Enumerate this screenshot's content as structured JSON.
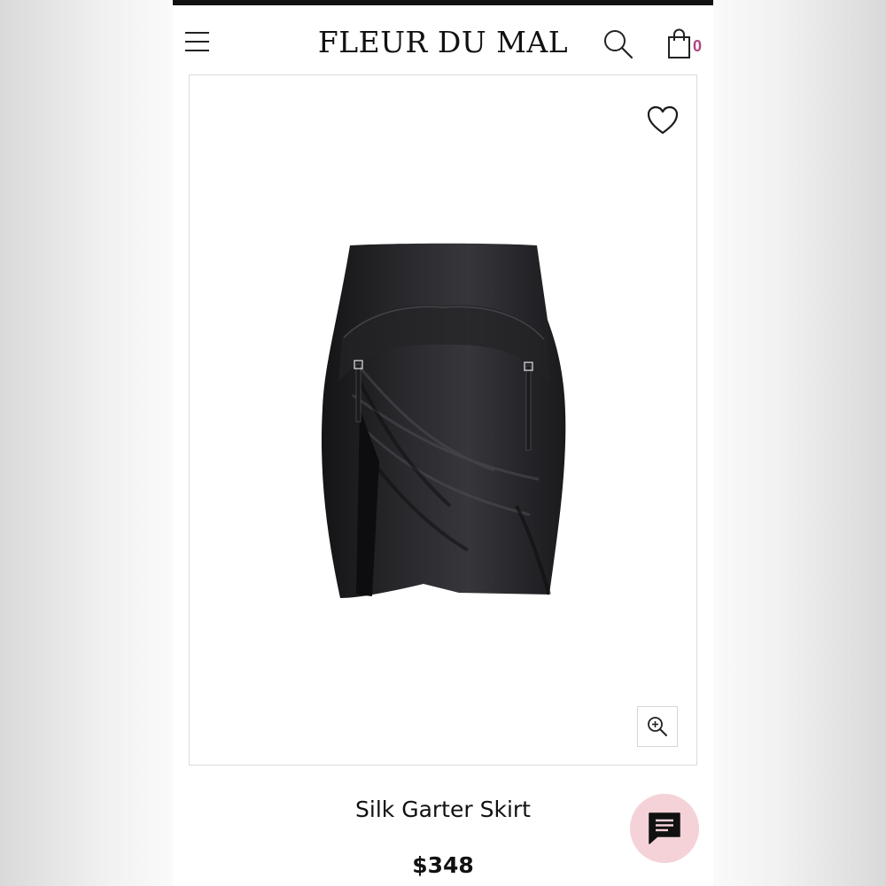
{
  "header": {
    "logo": "FLEUR DU MAL",
    "menu_icon": "hamburger-menu-icon",
    "search_icon": "search-icon",
    "cart_icon": "shopping-bag-icon",
    "cart_count": "0",
    "cart_count_color": "#b0437f"
  },
  "product": {
    "name": "Silk Garter Skirt",
    "price": "$348",
    "image": "black-silk-garter-skirt-photo",
    "wishlist_icon": "heart-outline-icon",
    "zoom_icon": "zoom-in-icon"
  },
  "chat": {
    "icon": "chat-bubble-icon",
    "background": "#f4d2d8"
  }
}
